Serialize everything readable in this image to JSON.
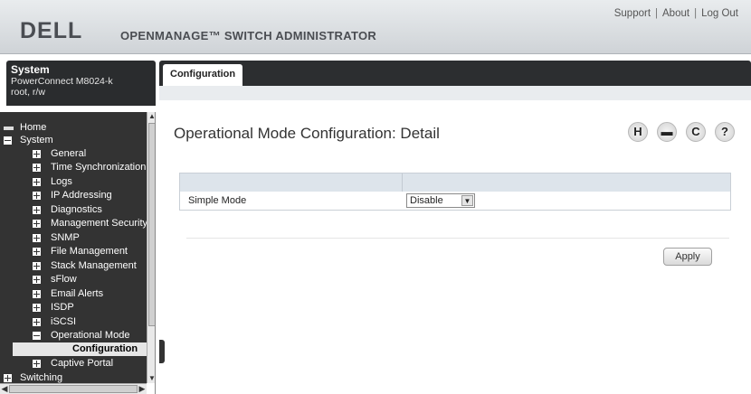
{
  "header": {
    "logo": "DELL",
    "app_title": "OPENMANAGE™ SWITCH ADMINISTRATOR",
    "links": [
      "Support",
      "About",
      "Log Out"
    ]
  },
  "system_box": {
    "title": "System",
    "device": "PowerConnect M8024-k",
    "user": "root, r/w"
  },
  "nav": {
    "items": [
      {
        "label": "Home"
      },
      {
        "label": "System"
      },
      {
        "label": "General"
      },
      {
        "label": "Time Synchronization"
      },
      {
        "label": "Logs"
      },
      {
        "label": "IP Addressing"
      },
      {
        "label": "Diagnostics"
      },
      {
        "label": "Management Security"
      },
      {
        "label": "SNMP"
      },
      {
        "label": "File Management"
      },
      {
        "label": "Stack Management"
      },
      {
        "label": "sFlow"
      },
      {
        "label": "Email Alerts"
      },
      {
        "label": "ISDP"
      },
      {
        "label": "iSCSI"
      },
      {
        "label": "Operational Mode"
      },
      {
        "label": "Configuration"
      },
      {
        "label": "Captive Portal"
      },
      {
        "label": "Switching"
      }
    ]
  },
  "tabs": [
    {
      "label": "Configuration"
    }
  ],
  "page": {
    "title": "Operational Mode Configuration: Detail",
    "toolbar_icons": [
      "save-icon",
      "print-icon",
      "refresh-icon",
      "help-icon"
    ],
    "form": {
      "rows": [
        {
          "label": "Simple Mode",
          "value": "Disable"
        }
      ]
    },
    "apply_label": "Apply"
  }
}
